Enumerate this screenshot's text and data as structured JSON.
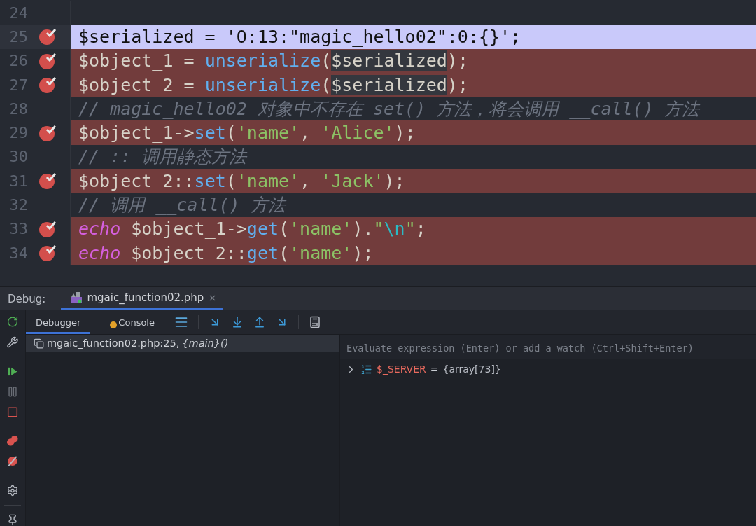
{
  "editor": {
    "lines": [
      {
        "number": "24",
        "kind": "plain",
        "breakpoint": false
      },
      {
        "number": "25",
        "kind": "current",
        "breakpoint": true,
        "tokens": [
          {
            "kind": "plain",
            "text": "$serialized = "
          },
          {
            "kind": "string",
            "text": "'O:13:\"magic_hello02\":0:{}'"
          },
          {
            "kind": "plain",
            "text": ";"
          }
        ]
      },
      {
        "number": "26",
        "kind": "breakpoint",
        "breakpoint": true,
        "tokens": [
          {
            "kind": "plain",
            "text": "$object_1 = "
          },
          {
            "kind": "function",
            "text": "unserialize"
          },
          {
            "kind": "plain",
            "text": "("
          },
          {
            "kind": "match",
            "text": "$serialized"
          },
          {
            "kind": "plain",
            "text": ");"
          }
        ]
      },
      {
        "number": "27",
        "kind": "breakpoint",
        "breakpoint": true,
        "tokens": [
          {
            "kind": "plain",
            "text": "$object_2 = "
          },
          {
            "kind": "function",
            "text": "unserialize"
          },
          {
            "kind": "plain",
            "text": "("
          },
          {
            "kind": "match",
            "text": "$serialized"
          },
          {
            "kind": "plain",
            "text": ");"
          }
        ]
      },
      {
        "number": "28",
        "kind": "plain",
        "breakpoint": false,
        "tokens": [
          {
            "kind": "comment",
            "text": "// magic_hello02 对象中不存在 set() 方法，将会调用 __call() 方法"
          }
        ]
      },
      {
        "number": "29",
        "kind": "breakpoint",
        "breakpoint": true,
        "tokens": [
          {
            "kind": "plain",
            "text": "$object_1->"
          },
          {
            "kind": "function",
            "text": "set"
          },
          {
            "kind": "plain",
            "text": "("
          },
          {
            "kind": "string",
            "text": "'name'"
          },
          {
            "kind": "plain",
            "text": ", "
          },
          {
            "kind": "string",
            "text": "'Alice'"
          },
          {
            "kind": "plain",
            "text": ");"
          }
        ]
      },
      {
        "number": "30",
        "kind": "plain",
        "breakpoint": false,
        "tokens": [
          {
            "kind": "comment",
            "text": "// :: 调用静态方法"
          }
        ]
      },
      {
        "number": "31",
        "kind": "breakpoint",
        "breakpoint": true,
        "tokens": [
          {
            "kind": "plain",
            "text": "$object_2::"
          },
          {
            "kind": "function",
            "text": "set"
          },
          {
            "kind": "plain",
            "text": "("
          },
          {
            "kind": "string",
            "text": "'name'"
          },
          {
            "kind": "plain",
            "text": ", "
          },
          {
            "kind": "string",
            "text": "'Jack'"
          },
          {
            "kind": "plain",
            "text": ");"
          }
        ]
      },
      {
        "number": "32",
        "kind": "plain",
        "breakpoint": false,
        "tokens": [
          {
            "kind": "comment",
            "text": "// 调用 __call() 方法"
          }
        ]
      },
      {
        "number": "33",
        "kind": "breakpoint",
        "breakpoint": true,
        "tokens": [
          {
            "kind": "keyword",
            "text": "echo"
          },
          {
            "kind": "plain",
            "text": " $object_1->"
          },
          {
            "kind": "function",
            "text": "get"
          },
          {
            "kind": "plain",
            "text": "("
          },
          {
            "kind": "string",
            "text": "'name'"
          },
          {
            "kind": "plain",
            "text": ")."
          },
          {
            "kind": "string",
            "text": "\""
          },
          {
            "kind": "escape",
            "text": "\\n"
          },
          {
            "kind": "string",
            "text": "\""
          },
          {
            "kind": "plain",
            "text": ";"
          }
        ]
      },
      {
        "number": "34",
        "kind": "breakpoint",
        "breakpoint": true,
        "tokens": [
          {
            "kind": "keyword",
            "text": "echo"
          },
          {
            "kind": "plain",
            "text": " $object_2::"
          },
          {
            "kind": "function",
            "text": "get"
          },
          {
            "kind": "plain",
            "text": "("
          },
          {
            "kind": "string",
            "text": "'name'"
          },
          {
            "kind": "plain",
            "text": ");"
          }
        ]
      }
    ]
  },
  "debug": {
    "label": "Debug:",
    "session_tab": {
      "title": "mgaic_function02.php",
      "selected": true
    },
    "tabs": [
      {
        "label": "Debugger",
        "selected": true
      },
      {
        "label": "Console",
        "selected": false
      }
    ],
    "frames": [
      {
        "location": "mgaic_function02.php:25,",
        "function": "{main}()",
        "selected": true
      }
    ],
    "watch": {
      "placeholder": "Evaluate expression (Enter) or add a watch (Ctrl+Shift+Enter)"
    },
    "variables": [
      {
        "name": "$_SERVER",
        "separator": "=",
        "value": "{array[73]}",
        "expanded": false
      }
    ]
  }
}
